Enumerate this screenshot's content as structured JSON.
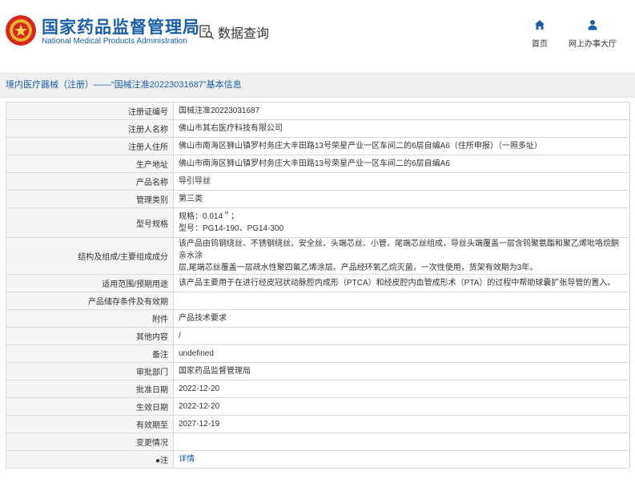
{
  "header": {
    "brand_cn": "国家药品监督管理局",
    "brand_en": "National Medical Products Administration",
    "query_label": "数据查询",
    "nav": [
      {
        "label": "首页",
        "icon": "home-icon"
      },
      {
        "label": "网上办事大厅",
        "icon": "user-icon"
      }
    ]
  },
  "breadcrumb": {
    "text": "境内医疗器械（注册）——“国械注准20223031687”基本信息"
  },
  "colors": {
    "brand_blue": "#1a5fa8",
    "label_bg": "#f5f5f5",
    "border": "#d9d9d9"
  },
  "rows": [
    {
      "label": "注册证编号",
      "value": "国械注准20223031687"
    },
    {
      "label": "注册人名称",
      "value": "佛山市其右医疗科技有限公司"
    },
    {
      "label": "注册人住所",
      "value": "佛山市南海区狮山镇罗村务庄大丰田路13号荣星产业一区车间二的6层自编A6（住所申报）（一照多址）"
    },
    {
      "label": "生产地址",
      "value": "佛山市南海区狮山镇罗村务庄大丰田路13号荣星产业一区车间二的6层自编A6"
    },
    {
      "label": "产品名称",
      "value": "导引导丝"
    },
    {
      "label": "管理类别",
      "value": "第三类"
    },
    {
      "label": "型号规格",
      "value_lines": [
        "规格：0.014＂；",
        "型号：PG14-190、PG14-300"
      ]
    },
    {
      "label": "结构及组成/主要组成成分",
      "value_lines": [
        "该产品由钨钢绕丝、不锈钢绕丝、安全丝、头端芯丝、小管、尾端芯丝组成，导丝头端覆盖一层含钨聚氨酯和聚乙烯吡咯烷酮亲水涂",
        "层,尾端芯丝覆盖一层疏水性聚四氟乙烯涂层。产品经环氧乙烷灭菌，一次性使用，货架有效期为3年。"
      ]
    },
    {
      "label": "适用范围/预期用途",
      "value": "该产品主要用于在进行经皮冠状动脉腔内成形（PTCA）和经皮腔内血管成形术（PTA）的过程中帮助球囊扩张导管的置入。"
    },
    {
      "label": "产品储存条件及有效期",
      "value": ""
    },
    {
      "label": "附件",
      "value": "产品技术要求"
    },
    {
      "label": "其他内容",
      "value": "/"
    },
    {
      "label": "备注",
      "value": "undefined"
    },
    {
      "label": "审批部门",
      "value": "国家药品监督管理局"
    },
    {
      "label": "批准日期",
      "value": "2022-12-20"
    },
    {
      "label": "生效日期",
      "value": "2022-12-20"
    },
    {
      "label": "有效期至",
      "value": "2027-12-19"
    },
    {
      "label": "变更情况",
      "value": ""
    },
    {
      "label": "●注",
      "value": "详情",
      "link": true
    }
  ]
}
